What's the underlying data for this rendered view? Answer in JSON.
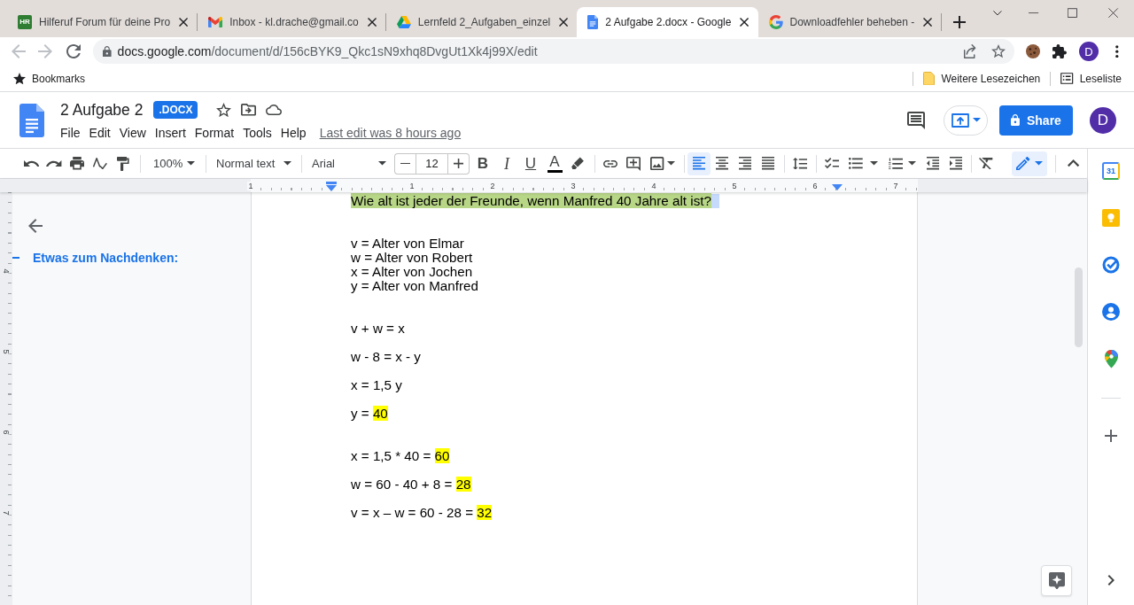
{
  "browser": {
    "tabs": [
      {
        "title": "Hilferuf Forum für deine Pro",
        "kind": "forum",
        "favicon_text": "HR",
        "selected": false
      },
      {
        "title": "Inbox - kl.drache@gmail.co",
        "kind": "gmail",
        "selected": false
      },
      {
        "title": "Lernfeld 2_Aufgaben_einzel",
        "kind": "drive",
        "selected": false
      },
      {
        "title": "2 Aufgabe 2.docx - Google",
        "kind": "docs",
        "selected": true
      },
      {
        "title": "Downloadfehler beheben -",
        "kind": "google",
        "selected": false
      }
    ],
    "navigation": [
      {
        "kind": "back",
        "disabled": true
      },
      {
        "kind": "forward",
        "disabled": true
      },
      {
        "kind": "reload",
        "disabled": false
      }
    ],
    "url_host": "docs.google.com",
    "url_path": "/document/d/156cBYK9_Qkc1sN9xhq8DvgUt1Xk4j99X/edit",
    "profile_initial": "D",
    "bookmarks": [
      {
        "label": "Bookmarks",
        "kind": "star"
      }
    ],
    "bookmarks_right": [
      {
        "label": "Weitere Lesezeichen",
        "kind": "folder"
      },
      {
        "label": "Leseliste",
        "kind": "reading_list"
      }
    ]
  },
  "docs": {
    "title": "2 Aufgabe 2",
    "badge": ".DOCX",
    "menus": [
      "File",
      "Edit",
      "View",
      "Insert",
      "Format",
      "Tools",
      "Help"
    ],
    "last_edit": "Last edit was 8 hours ago",
    "share": "Share",
    "profile_initial": "D"
  },
  "toolbar": {
    "zoom": "100%",
    "style": "Normal text",
    "font": "Arial",
    "font_size": "12",
    "format_buttons": [
      {
        "label": "B",
        "kind": "bold"
      },
      {
        "label": "I",
        "kind": "italic"
      },
      {
        "label": "U",
        "kind": "underline"
      },
      {
        "label": "A",
        "kind": "text_color"
      }
    ],
    "alignment": [
      {
        "kind": "left",
        "selected": true
      },
      {
        "kind": "center",
        "selected": false
      },
      {
        "kind": "right",
        "selected": false
      },
      {
        "kind": "justify",
        "selected": false
      }
    ]
  },
  "ruler": {
    "labels": [
      "1",
      "1",
      "2",
      "3",
      "4",
      "5",
      "6",
      "7"
    ]
  },
  "vertical_ruler": {
    "labels": [
      "4",
      "5",
      "6",
      "7"
    ]
  },
  "outline": {
    "headings": [
      {
        "text": "Etwas zum Nachdenken:",
        "selected": true
      }
    ]
  },
  "document": {
    "blocks": [
      {
        "kind": "plain",
        "lines": [
          {
            "selected": true,
            "runs": [
              {
                "text": "Wie alt ist jeder der Freunde, wenn Manfred 40 Jahre alt ist?",
                "highlight": true
              }
            ]
          }
        ]
      },
      {
        "kind": "plain",
        "lines": [
          {
            "selected": false,
            "runs": [
              {
                "text": "v = Alter von Elmar",
                "highlight": false
              }
            ]
          },
          {
            "selected": false,
            "runs": [
              {
                "text": "w = Alter von Robert",
                "highlight": false
              }
            ]
          },
          {
            "selected": false,
            "runs": [
              {
                "text": "x = Alter von Jochen",
                "highlight": false
              }
            ]
          },
          {
            "selected": false,
            "runs": [
              {
                "text": "y = Alter von Manfred",
                "highlight": false
              }
            ]
          }
        ]
      },
      {
        "kind": "spaced",
        "lines": [
          {
            "selected": false,
            "runs": [
              {
                "text": "v + w = x",
                "highlight": false
              }
            ]
          },
          {
            "selected": false,
            "runs": [
              {
                "text": "w - 8 = x - y",
                "highlight": false
              }
            ]
          },
          {
            "selected": false,
            "runs": [
              {
                "text": "x = 1,5 y",
                "highlight": false
              }
            ]
          },
          {
            "selected": false,
            "runs": [
              {
                "text": "y = ",
                "highlight": false
              },
              {
                "text": "40",
                "highlight": true
              }
            ]
          }
        ]
      },
      {
        "kind": "spaced",
        "lines": [
          {
            "selected": false,
            "runs": [
              {
                "text": "x = 1,5 * 40 = ",
                "highlight": false
              },
              {
                "text": "60",
                "highlight": true
              }
            ]
          },
          {
            "selected": false,
            "runs": [
              {
                "text": "w = 60 - 40 + 8 = ",
                "highlight": false
              },
              {
                "text": "28",
                "highlight": true
              }
            ]
          },
          {
            "selected": false,
            "runs": [
              {
                "text": "v = x – w = 60 - 28 = ",
                "highlight": false
              },
              {
                "text": "32",
                "highlight": true
              }
            ]
          }
        ]
      }
    ]
  },
  "side_panel": {
    "apps": [
      {
        "kind": "calendar",
        "label": "31"
      },
      {
        "kind": "keep"
      },
      {
        "kind": "tasks"
      },
      {
        "kind": "contacts"
      },
      {
        "kind": "maps"
      }
    ]
  }
}
